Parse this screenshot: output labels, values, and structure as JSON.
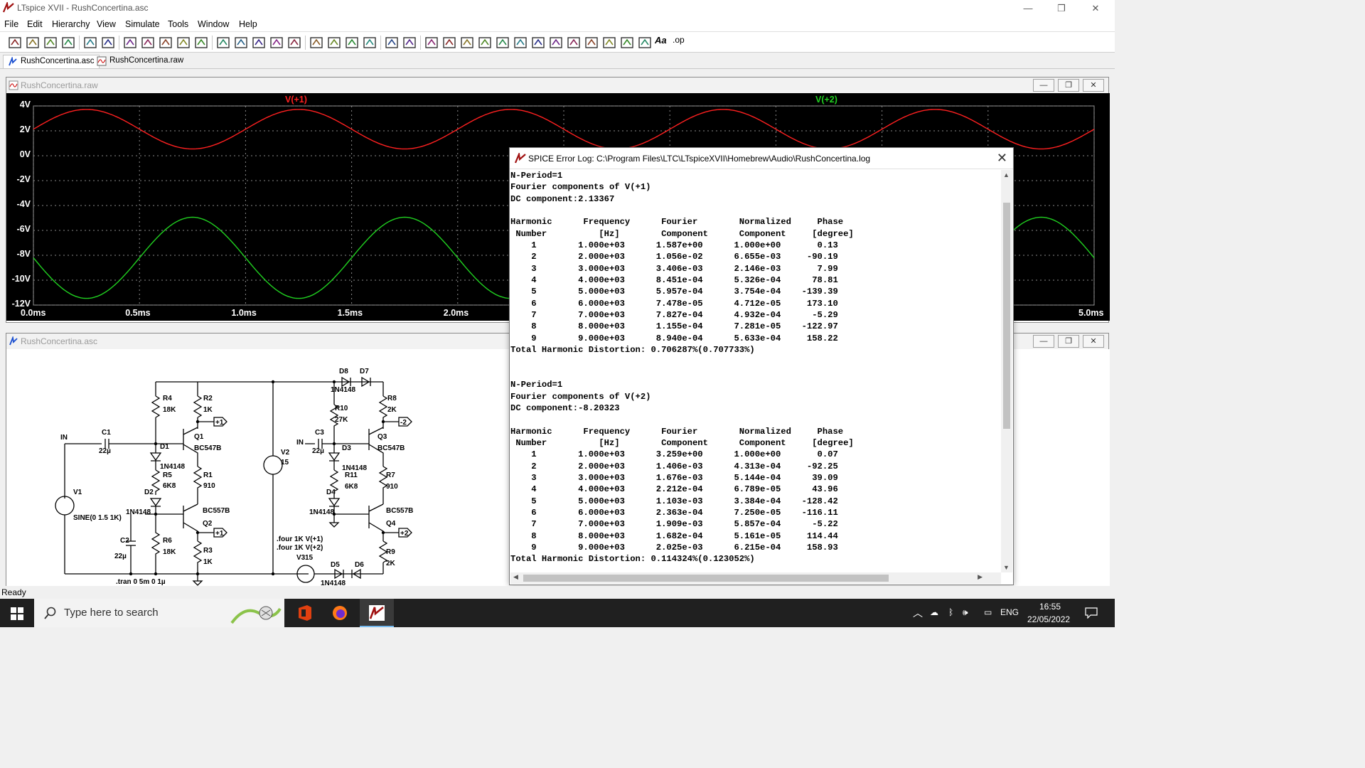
{
  "window": {
    "title": "LTspice XVII - RushConcertina.asc",
    "minimize": "—",
    "maximize": "❐",
    "close": "✕"
  },
  "menu": [
    "File",
    "Edit",
    "Hierarchy",
    "View",
    "Simulate",
    "Tools",
    "Window",
    "Help"
  ],
  "toolbar": {
    "icons": [
      "run-icon",
      "open-icon",
      "save-icon",
      "control-panel-icon",
      "run-sim-icon",
      "pan-icon",
      "zoom-in-icon",
      "zoom-fit-icon",
      "zoom-out-icon",
      "zoom-cancel-icon",
      "autorange-icon",
      "grid-icon",
      "tile-icon",
      "cascade-icon",
      "close-all-icon",
      "cut-icon",
      "copy-icon",
      "paste-icon",
      "find-icon",
      "print-icon",
      "print-setup-icon",
      "pencil-icon",
      "ground-icon",
      "label-icon",
      "wire-icon",
      "resistor-icon",
      "capacitor-icon",
      "inductor-icon",
      "diode-icon",
      "move-icon",
      "drag-icon",
      "undo-icon",
      "redo-icon",
      "rotate-icon",
      "mirror-icon",
      "text-icon",
      "spice-directive-icon"
    ],
    "text_label": "Aa",
    "op_label": ".op"
  },
  "tabs": [
    {
      "label": "RushConcertina.asc",
      "active": true
    },
    {
      "label": "RushConcertina.raw",
      "active": false
    }
  ],
  "waveform": {
    "title": "RushConcertina.raw",
    "trace1_label": "V(+1)",
    "trace2_label": "V(+2)",
    "trace1_color": "#ff2020",
    "trace2_color": "#20d020",
    "y_ticks": [
      "4V",
      "2V",
      "0V",
      "-2V",
      "-4V",
      "-6V",
      "-8V",
      "-10V",
      "-12V"
    ],
    "x_ticks": [
      "0.0ms",
      "0.5ms",
      "1.0ms",
      "1.5ms",
      "2.0ms",
      "5.0ms"
    ],
    "trace1_amp_v": 1.587,
    "trace1_offset_v": 2.134,
    "trace2_amp_v": 3.259,
    "trace2_offset_v": -8.203,
    "frequency_hz": 1000,
    "phase_note": "traces in anti-phase"
  },
  "schematic": {
    "title": "RushConcertina.asc",
    "labels": {
      "r4": "R4",
      "r4v": "18K",
      "r2": "R2",
      "r2v": "1K",
      "q1": "Q1",
      "q1v": "BC547B",
      "c1": "C1",
      "c1v": "22µ",
      "in1": "IN",
      "d1": "D1",
      "d1v": "1N4148",
      "r5": "R5",
      "r5v": "6K8",
      "r1": "R1",
      "r1v": "910",
      "d2": "D2",
      "d2v": "1N4148",
      "q2v": "BC557B",
      "q2": "Q2",
      "r6": "R6",
      "r6v": "18K",
      "r3": "R3",
      "r3v": "1K",
      "c2": "C2",
      "c2v": "22µ",
      "v1": "V1",
      "v1v": "SINE(0 1.5 1K)",
      "tran": ".tran 0 5m 0 1µ",
      "v2": "V2",
      "v2v": "15",
      "four1": ".four 1K V(+1)",
      "four2": ".four 1K V(+2)",
      "v3": "V3",
      "v3v": "15",
      "d8": "D8",
      "d7": "D7",
      "d87v": "1N4148",
      "r10": "R10",
      "r10v": "27K",
      "r8": "R8",
      "r8v": "2K",
      "c3": "C3",
      "c3v": "22µ",
      "in2": "IN",
      "d3": "D3",
      "d3v": "1N4148",
      "q3": "Q3",
      "q3v": "BC547B",
      "r11": "R11",
      "r11v": "6K8",
      "r7": "R7",
      "r7v": "910",
      "d4": "D4",
      "d4v": "1N4148",
      "q4v": "BC557B",
      "q4": "Q4",
      "r9": "R9",
      "r9v": "2K",
      "d5": "D5",
      "d6": "D6",
      "d56v": "1N4148",
      "p1": "+1",
      "p2": "-2",
      "p3": "+1",
      "p4": "+2"
    }
  },
  "error_log": {
    "title": "SPICE Error Log: C:\\Program Files\\LTC\\LTspiceXVII\\Homebrew\\Audio\\RushConcertina.log",
    "lines": [
      "N-Period=1",
      "Fourier components of V(+1)",
      "DC component:2.13367",
      "",
      "Harmonic      Frequency      Fourier        Normalized     Phase",
      " Number          [Hz]        Component      Component     [degree]",
      "    1        1.000e+03      1.587e+00      1.000e+00       0.13",
      "    2        2.000e+03      1.056e-02      6.655e-03     -90.19",
      "    3        3.000e+03      3.406e-03      2.146e-03       7.99",
      "    4        4.000e+03      8.451e-04      5.326e-04      78.81",
      "    5        5.000e+03      5.957e-04      3.754e-04    -139.39",
      "    6        6.000e+03      7.478e-05      4.712e-05     173.10",
      "    7        7.000e+03      7.827e-04      4.932e-04      -5.29",
      "    8        8.000e+03      1.155e-04      7.281e-05    -122.97",
      "    9        9.000e+03      8.940e-04      5.633e-04     158.22",
      "Total Harmonic Distortion: 0.706287%(0.707733%)",
      "",
      "",
      "N-Period=1",
      "Fourier components of V(+2)",
      "DC component:-8.20323",
      "",
      "Harmonic      Frequency      Fourier        Normalized     Phase",
      " Number          [Hz]        Component      Component     [degree]",
      "    1        1.000e+03      3.259e+00      1.000e+00       0.07",
      "    2        2.000e+03      1.406e-03      4.313e-04     -92.25",
      "    3        3.000e+03      1.676e-03      5.144e-04      39.09",
      "    4        4.000e+03      2.212e-04      6.789e-05      43.96",
      "    5        5.000e+03      1.103e-03      3.384e-04    -128.42",
      "    6        6.000e+03      2.363e-04      7.250e-05    -116.11",
      "    7        7.000e+03      1.909e-03      5.857e-04      -5.22",
      "    8        8.000e+03      1.682e-04      5.161e-05     114.44",
      "    9        9.000e+03      2.025e-03      6.215e-04     158.93",
      "Total Harmonic Distortion: 0.114324%(0.123052%)"
    ]
  },
  "status": "Ready",
  "taskbar": {
    "search_placeholder": "Type here to search",
    "lang": "ENG",
    "time": "16:55",
    "date": "22/05/2022"
  }
}
